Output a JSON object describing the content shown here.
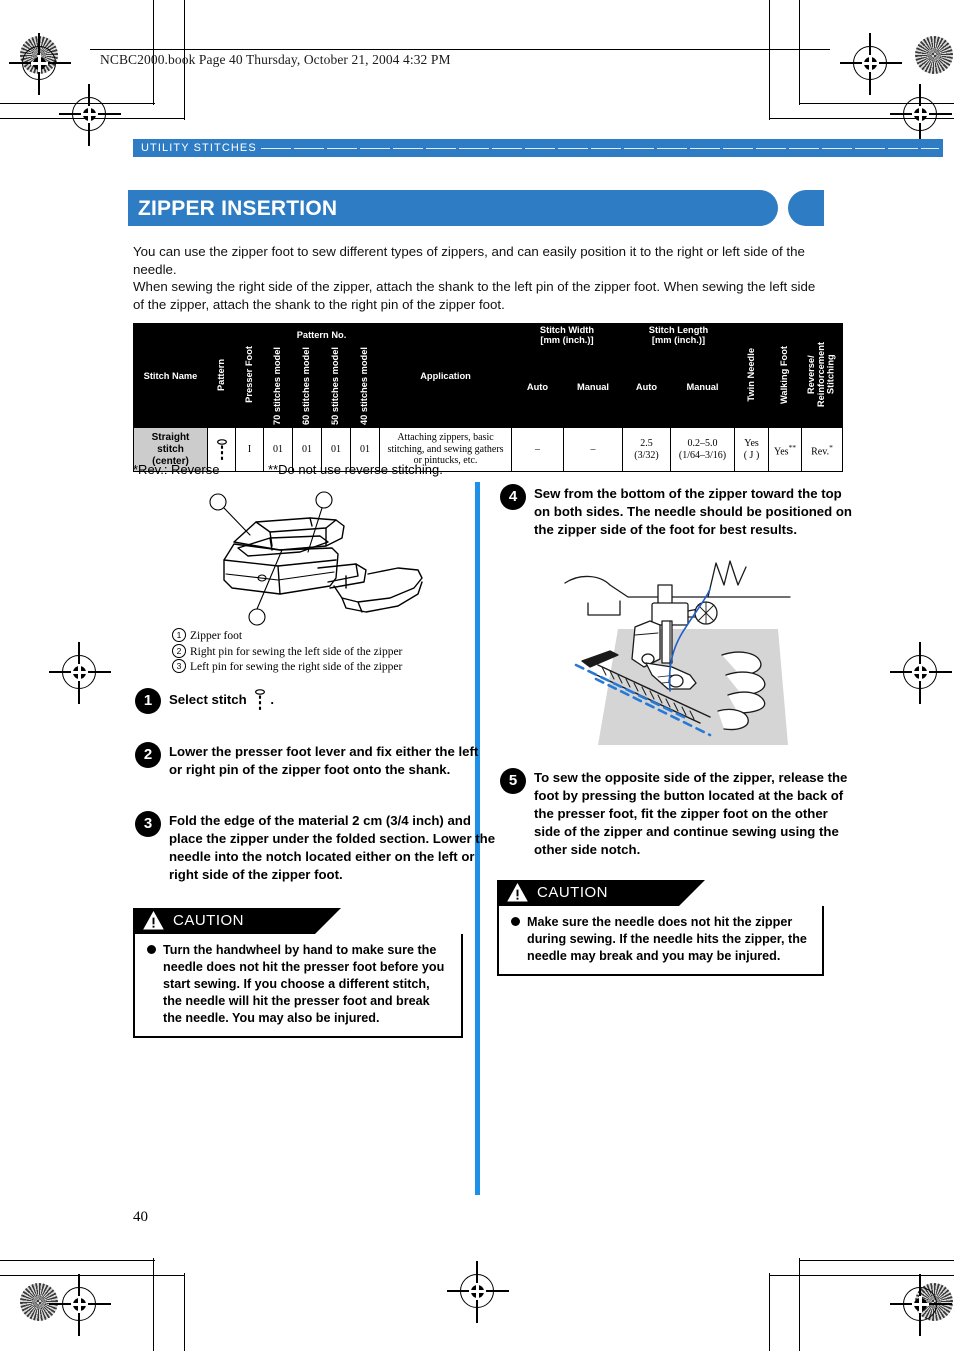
{
  "running_head": {
    "text": "NCBC2000.book  Page 40  Thursday, October 21, 2004  4:32 PM"
  },
  "section": {
    "label": "UTILITY STITCHES"
  },
  "title": {
    "text": "ZIPPER INSERTION"
  },
  "intro": {
    "paragraph1": "You can use the zipper foot to sew different types of zippers, and can easily position it to the right or left side of the needle.",
    "paragraph2": "When sewing the right side of the zipper, attach the shank to the left pin of the zipper foot. When sewing the left side of the zipper, attach the shank to the right pin of the zipper foot."
  },
  "spec_table": {
    "headers": {
      "stitch_name": "Stitch Name",
      "pattern": "Pattern",
      "presser_foot": "Presser Foot",
      "pattern_no": "Pattern No.",
      "pattern_no_cols": [
        "70 stitches model",
        "60 stitches model",
        "50 stitches model",
        "40 stitches model"
      ],
      "application": "Application",
      "stitch_width": "Stitch Width [mm (inch.)]",
      "stitch_width_line1": "Stitch Width",
      "stitch_width_line2": "[mm (inch.)]",
      "stitch_length_line1": "Stitch Length",
      "stitch_length_line2": "[mm (inch.)]",
      "auto": "Auto",
      "manual": "Manual",
      "twin_needle": "Twin Needle",
      "walking_foot": "Walking Foot",
      "reverse_reinforcement": "Reverse/ Reinforcement Stitching",
      "reverse_l1": "Reverse/",
      "reverse_l2": "Reinforcement",
      "reverse_l3": "Stitching"
    },
    "row": {
      "stitch_name_l1": "Straight",
      "stitch_name_l2": "stitch",
      "stitch_name_l3": "(center)",
      "pattern_icon": "straight-stitch-icon",
      "presser_foot": "I",
      "p70": "01",
      "p60": "01",
      "p50": "01",
      "p40": "01",
      "application": "Attaching zippers, basic stitching, and sewing gathers or pintucks, etc.",
      "width_auto": "–",
      "width_manual": "–",
      "length_auto_l1": "2.5",
      "length_auto_l2": "(3/32)",
      "length_manual_l1": "0.2–5.0",
      "length_manual_l2": "(1/64–3/16)",
      "twin_needle_l1": "Yes",
      "twin_needle_l2": "( J )",
      "walking_foot": "Yes",
      "walking_foot_sup": "**",
      "reverse": "Rev.",
      "reverse_sup": "*"
    },
    "footnote_left": "*Rev.: Reverse",
    "footnote_right": "**Do not use reverse stitching."
  },
  "figure_left": {
    "callout_1": "1",
    "callout_2": "2",
    "callout_3": "3",
    "captions": [
      {
        "num": "1",
        "text": "Zipper foot"
      },
      {
        "num": "2",
        "text": "Right pin for sewing the left side of the zipper"
      },
      {
        "num": "3",
        "text": "Left pin for sewing the right side of the zipper"
      }
    ]
  },
  "steps": [
    {
      "number": "1",
      "text_before": "Select stitch",
      "text_after": ".",
      "icon": "straight-stitch-icon"
    },
    {
      "number": "2",
      "text": "Lower the presser foot lever and fix either the left or right pin of the zipper foot onto the shank."
    },
    {
      "number": "3",
      "text": "Fold the edge of the material 2 cm (3/4 inch) and place the zipper under the folded section. Lower the needle into the notch located either on the left or right side of the zipper foot."
    },
    {
      "number": "4",
      "text": "Sew from the bottom of the zipper toward the top on both sides. The needle should be positioned on the zipper side of the foot for best results."
    },
    {
      "number": "5",
      "text": "To sew the opposite side of the zipper, release the foot by pressing the button located at the back of the presser foot, fit the zipper foot on the other side of the zipper and continue sewing using the other side notch."
    }
  ],
  "caution_left": {
    "heading": "CAUTION",
    "body": "Turn the handwheel by hand to make sure the needle does not hit the presser foot before you start sewing. If you choose a different stitch, the needle will hit the presser foot and break the needle. You may also be injured."
  },
  "caution_right": {
    "heading": "CAUTION",
    "body": "Make sure the needle does not hit the zipper during sewing. If the needle hits the zipper, the needle may break and you may be injured."
  },
  "page_number": "40",
  "colors": {
    "accent_blue": "#2e7dc4",
    "divider_blue": "#1e90e8",
    "table_header": "#000000",
    "name_cell": "#cccccc"
  }
}
